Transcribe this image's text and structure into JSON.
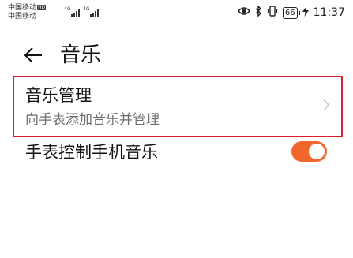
{
  "status_bar": {
    "carrier_1": "中国移动",
    "hd_label": "HD",
    "carrier_2": "中国移动",
    "signal_tag_1": "4G",
    "signal_tag_2": "4G",
    "battery_level": "66",
    "time": "11:37"
  },
  "header": {
    "title": "音乐",
    "back_icon": "arrow-left-icon"
  },
  "music_management": {
    "title": "音乐管理",
    "subtitle": "向手表添加音乐并管理",
    "highlight_color": "#d9202a"
  },
  "watch_control": {
    "label": "手表控制手机音乐",
    "enabled": true,
    "toggle_color": "#f1662b"
  }
}
